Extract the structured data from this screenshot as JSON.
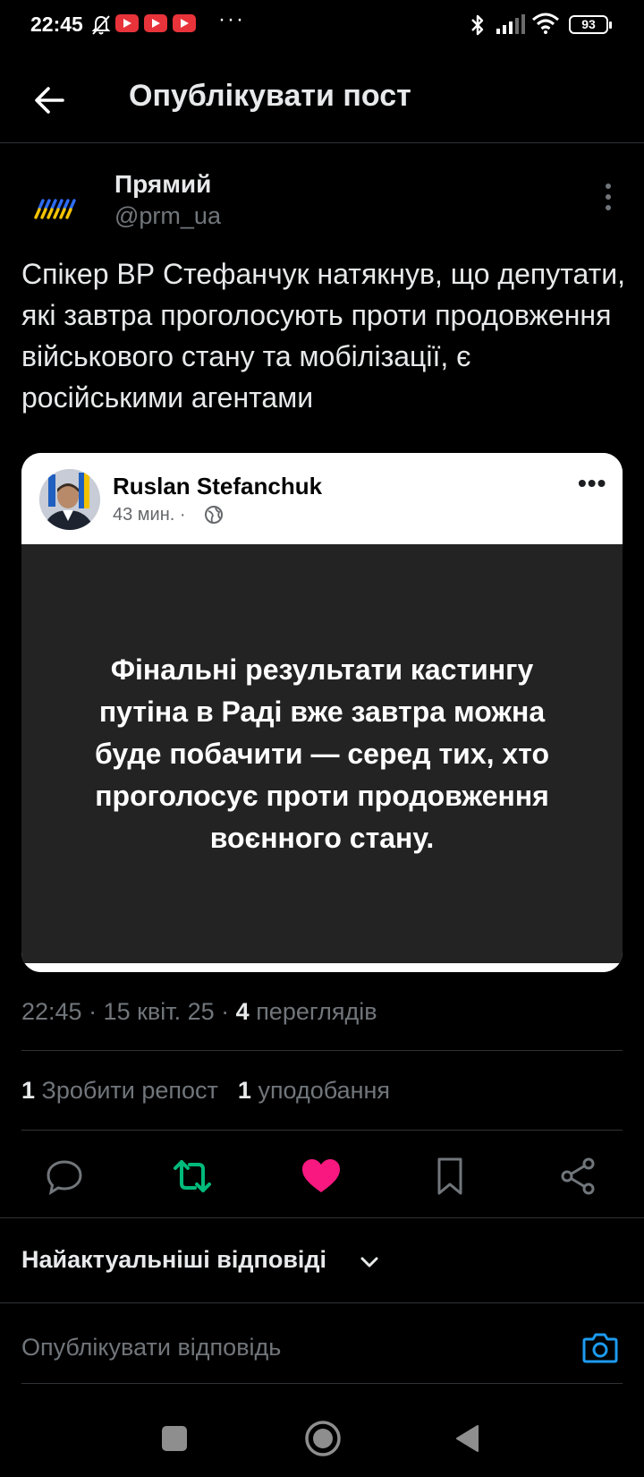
{
  "status_bar": {
    "time": "22:45",
    "icons": [
      "bell-off-icon",
      "youtube-icon",
      "youtube-icon",
      "youtube-icon",
      "more-dots",
      "bluetooth-icon",
      "signal-icon",
      "wifi-icon",
      "battery-icon"
    ],
    "dots": "···",
    "battery": "93"
  },
  "header": {
    "title": "Опублікувати пост"
  },
  "author": {
    "name": "Прямий",
    "handle": "@prm_ua"
  },
  "post": {
    "text": "Спікер ВР Стефанчук натякнув, що депутати, які завтра проголосують проти продовження військового стану та мобілізації, є російськими агентами"
  },
  "embed": {
    "name": "Ruslan Stefanchuk",
    "meta": "43 мин. ·",
    "more": "•••",
    "quote": "Фінальні результати кастингу путіна в Раді вже завтра можна буде побачити — серед тих, хто проголосує проти продовження воєнного стану."
  },
  "meta": {
    "time_date": "22:45 · 15 квіт. 25 · ",
    "views_count": "4",
    "views_label": " переглядів"
  },
  "stats": {
    "reposts_count": "1",
    "reposts_label": " Зробити репост",
    "likes_count": "1",
    "likes_label": " уподобання"
  },
  "colors": {
    "repost": "#00ba7c",
    "like": "#f91880",
    "accent": "#1d9bf0"
  },
  "replies": {
    "sort_label": "Найактуальніші відповіді",
    "input_placeholder": "Опублікувати відповідь"
  }
}
